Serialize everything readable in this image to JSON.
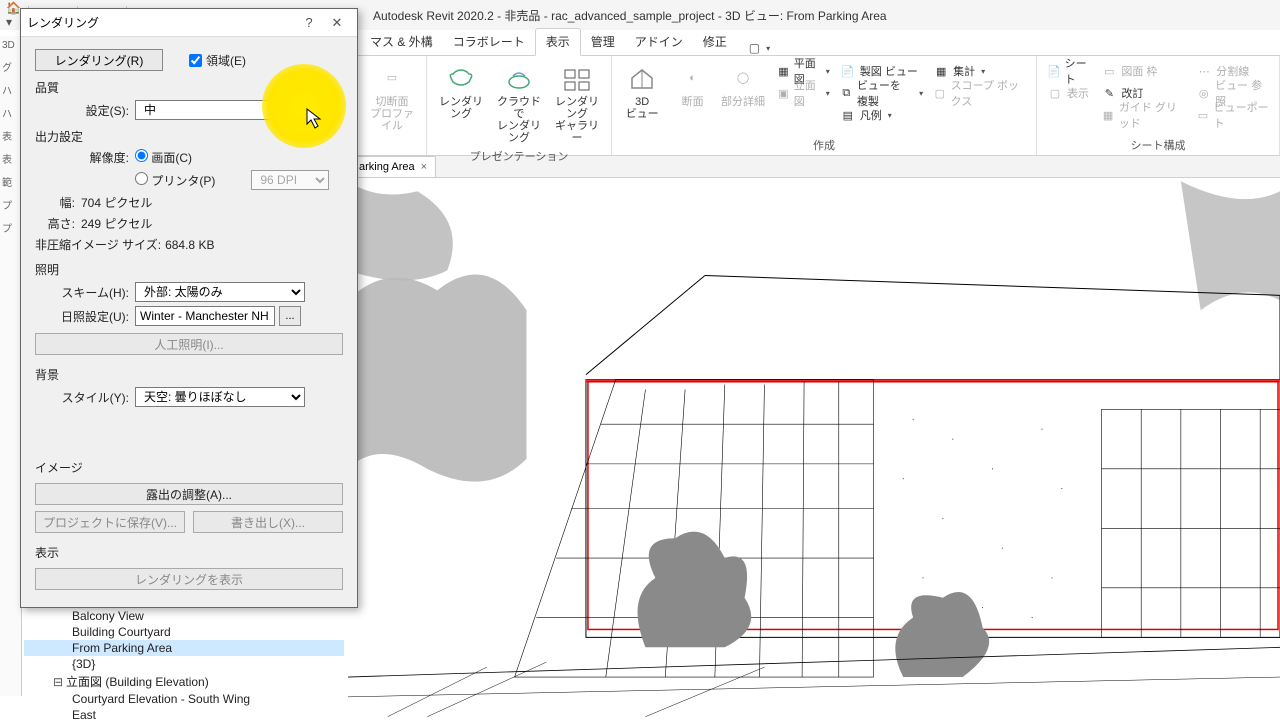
{
  "app_title": "Autodesk Revit 2020.2 - 非売品 - rac_advanced_sample_project - 3D ビュー: From Parking Area",
  "ribbon": {
    "tabs": [
      "マス & 外構",
      "コラボレート",
      "表示",
      "管理",
      "アドイン",
      "修正"
    ],
    "active_tab": "表示",
    "panels": {
      "p1": {
        "btn1": "切断面\nプロファイル",
        "label": ""
      },
      "presentation": {
        "b1": "レンダリング",
        "b2": "クラウドで\nレンダリング",
        "b3": "レンダリング\nギャラリー",
        "label": "プレゼンテーション"
      },
      "create": {
        "b1": "3D\nビュー",
        "b2": "断面",
        "b3": "部分詳細",
        "s1": "平面図",
        "s2": "立面図",
        "s3": "製図 ビュー",
        "s4": "ビューを 複製",
        "s5": "凡例",
        "s6": "集計",
        "s7": "スコープ ボックス",
        "label": "作成"
      },
      "sheet": {
        "s1": "シート",
        "s2": "図面 枠",
        "s3": "表示",
        "s4": "改訂",
        "s5": "ガイド グリッド",
        "s6": "分割線",
        "s7": "ビュー 参照",
        "s8": "ビューポート",
        "label": "シート構成"
      }
    }
  },
  "viewtab": {
    "name": "arking Area",
    "close": "×"
  },
  "dialog": {
    "title": "レンダリング",
    "render_btn": "レンダリング(R)",
    "region_chk": "領域(E)",
    "quality_label": "品質",
    "setting_label": "設定(S):",
    "setting_value": "中",
    "output_label": "出力設定",
    "resolution_label": "解像度:",
    "res_screen": "画面(C)",
    "res_printer": "プリンタ(P)",
    "dpi": "96 DPI",
    "width_label": "幅:",
    "width_val": "704 ピクセル",
    "height_label": "高さ:",
    "height_val": "249 ピクセル",
    "size_label": "非圧縮イメージ サイズ:",
    "size_val": "684.8 KB",
    "lighting_label": "照明",
    "scheme_label": "スキーム(H):",
    "scheme_val": "外部: 太陽のみ",
    "sun_label": "日照設定(U):",
    "sun_val": "Winter - Manchester NH,",
    "artificial": "人工照明(I)...",
    "background_label": "背景",
    "style_label": "スタイル(Y):",
    "style_val": "天空: 曇りほぼなし",
    "image_label": "イメージ",
    "exposure_btn": "露出の調整(A)...",
    "save_proj": "プロジェクトに保存(V)...",
    "export": "書き出し(X)...",
    "display_label": "表示",
    "show_render": "レンダリングを表示"
  },
  "browser": {
    "n0": "Balcony View",
    "n1": "Building Courtyard",
    "n2": "From Parking Area",
    "n3": "{3D}",
    "n4": "立面図 (Building Elevation)",
    "n5": "Courtyard Elevation - South Wing",
    "n6": "East"
  }
}
